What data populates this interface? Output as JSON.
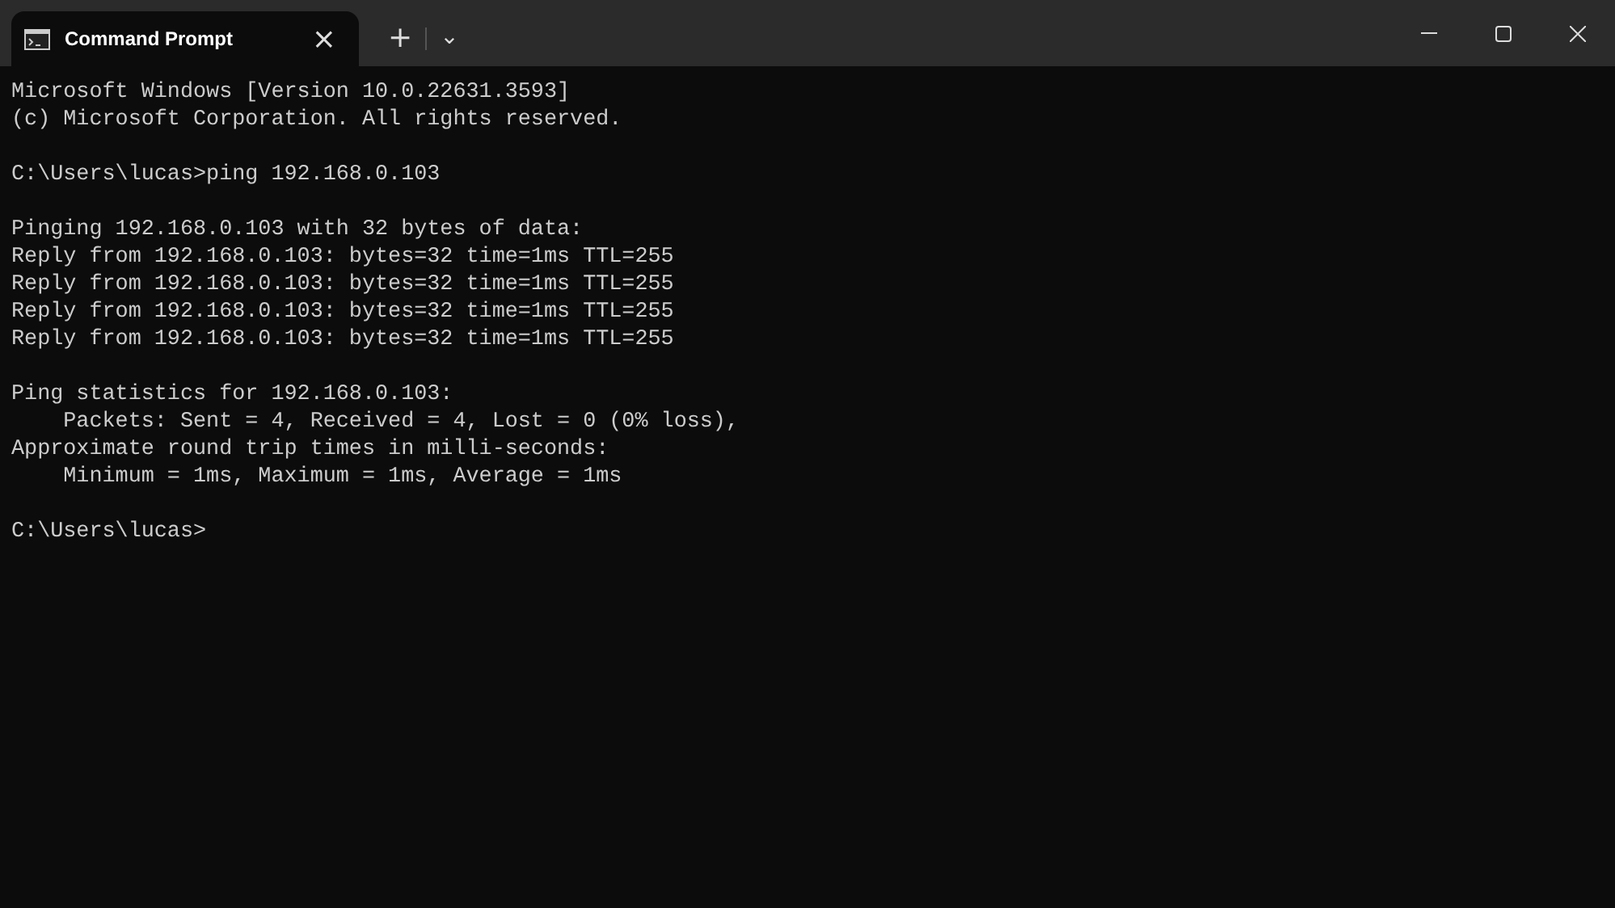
{
  "tab": {
    "title": "Command Prompt",
    "close": "×",
    "selected": true
  },
  "tab_bar": {
    "new_tab": "+",
    "dropdown": "⌄"
  },
  "console": {
    "blocks": [
      [
        "Microsoft Windows [Version 10.0.22631.3593]",
        "(c) Microsoft Corporation. All rights reserved."
      ],
      [
        "C:\\Users\\lucas>ping 192.168.0.103"
      ],
      [
        "Pinging 192.168.0.103 with 32 bytes of data:",
        "Reply from 192.168.0.103: bytes=32 time=1ms TTL=255",
        "Reply from 192.168.0.103: bytes=32 time=1ms TTL=255",
        "Reply from 192.168.0.103: bytes=32 time=1ms TTL=255",
        "Reply from 192.168.0.103: bytes=32 time=1ms TTL=255"
      ],
      [
        "Ping statistics for 192.168.0.103:",
        "    Packets: Sent = 4, Received = 4, Lost = 0 (0% loss),",
        "Approximate round trip times in milli-seconds:",
        "    Minimum = 1ms, Maximum = 1ms, Average = 1ms"
      ],
      [
        "C:\\Users\\lucas>"
      ]
    ]
  }
}
